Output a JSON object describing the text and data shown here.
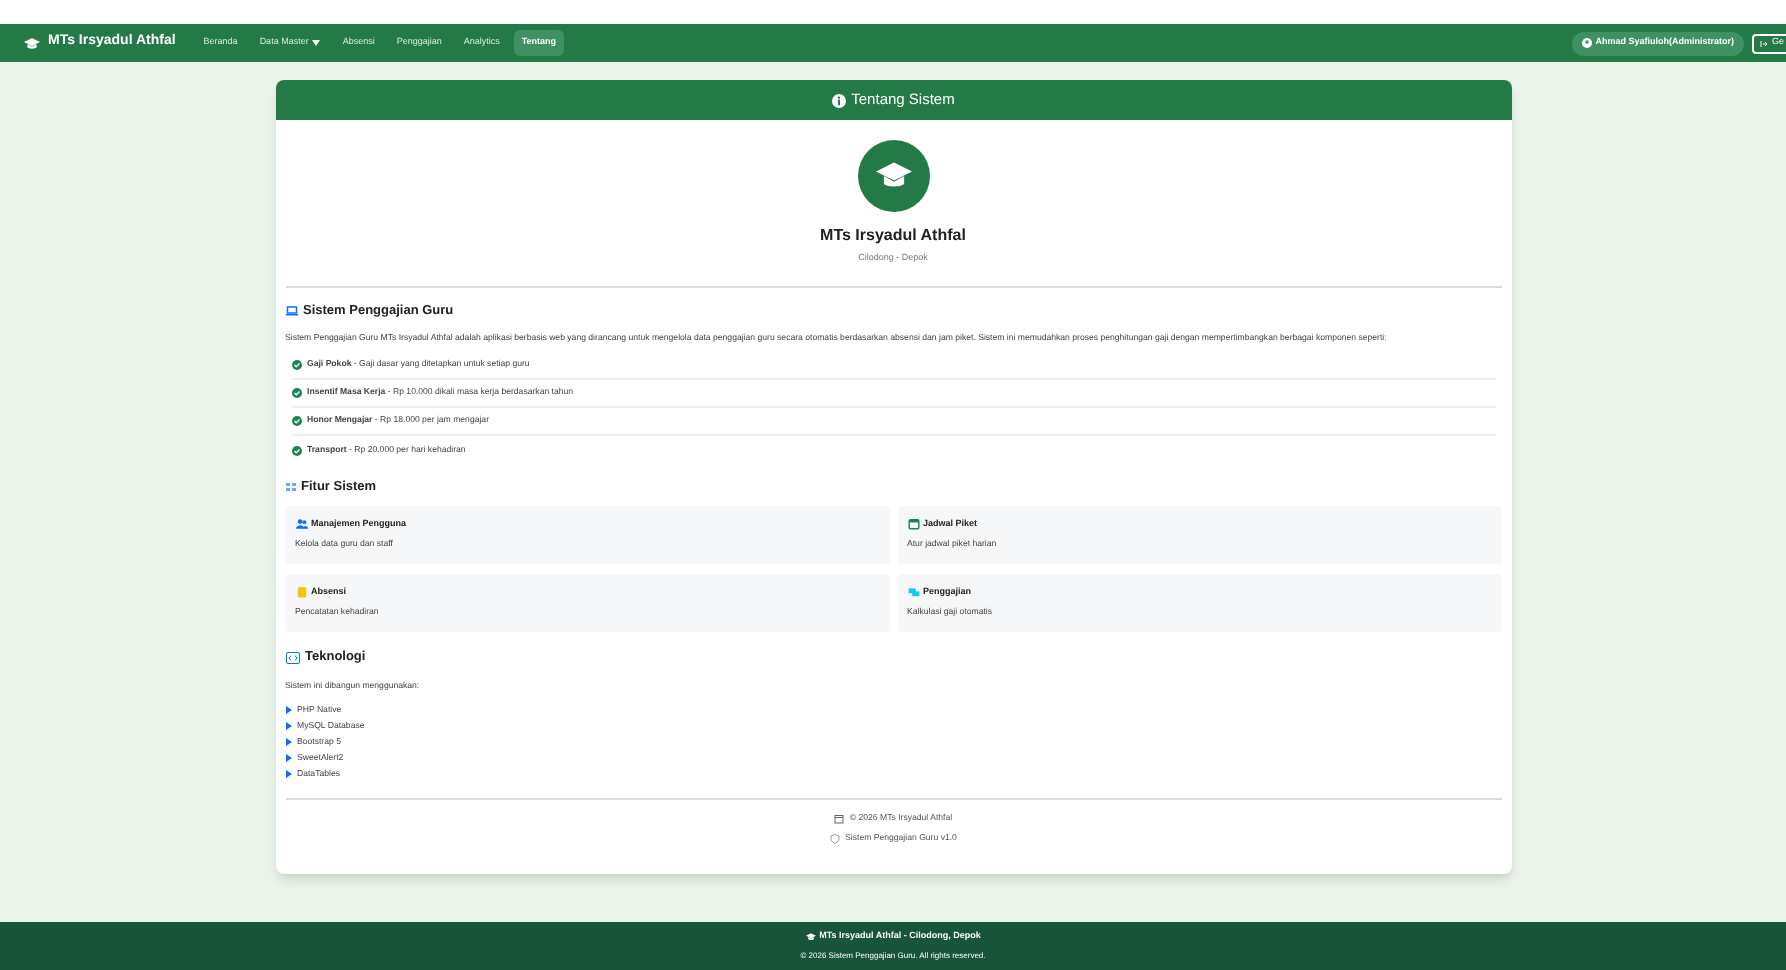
{
  "navbar": {
    "brand": "MTs Irsyadul Athfal",
    "items": [
      {
        "label": "Beranda",
        "selected": false,
        "dropdown": false
      },
      {
        "label": "Data Master",
        "selected": false,
        "dropdown": true
      },
      {
        "label": "Absensi",
        "selected": false,
        "dropdown": false
      },
      {
        "label": "Penggajian",
        "selected": false,
        "dropdown": false
      },
      {
        "label": "Analytics",
        "selected": false,
        "dropdown": false
      },
      {
        "label": "Tentang",
        "selected": true,
        "dropdown": false
      }
    ],
    "user": "Ahmad Syafiuloh(Administrator)",
    "logout": "Ge"
  },
  "card": {
    "title": "Tentang Sistem",
    "school": "MTs Irsyadul Athfal",
    "location": "Cilodong - Depok",
    "section_1": {
      "heading": "Sistem Penggajian Guru",
      "text": "Sistem Penggajian Guru MTs Irsyadul Athfal adalah aplikasi berbasis web yang dirancang untuk mengelola data penggajian guru secara otomatis berdasarkan absensi dan jam piket. Sistem ini memudahkan proses penghitungan gaji dengan mempertimbangkan berbagai komponen seperti:",
      "components": [
        {
          "text": "**Gaji Pokok** - Gaji dasar yang ditetapkan untuk setiap guru"
        },
        {
          "text": "**Insentif Masa Kerja** - Rp 10.000 dikali masa kerja berdasarkan tahun"
        },
        {
          "text": "**Honor Mengajar** - Rp 18.000 per jam mengajar"
        },
        {
          "text": "**Transport** - Rp 20.000 per hari kehadiran"
        }
      ]
    },
    "section_2": {
      "heading": "Fitur Sistem",
      "features": [
        {
          "kind": "users",
          "title": "Manajemen Pengguna",
          "desc": "Kelola data guru dan staff",
          "color": "#0d6efd"
        },
        {
          "kind": "calendar",
          "title": "Jadwal Piket",
          "desc": "Atur jadwal piket harian",
          "color": "#198754"
        },
        {
          "kind": "clipboard",
          "title": "Absensi",
          "desc": "Pencatatan kehadiran",
          "color": "#ffc107"
        },
        {
          "kind": "money",
          "title": "Penggajian",
          "desc": "Kalkulasi gaji otomatis",
          "color": "#0dcaf0"
        }
      ]
    },
    "section_3": {
      "heading": "Teknologi",
      "intro": "Sistem ini dibangun menggunakan:",
      "items": [
        "PHP Native",
        "MySQL Database",
        "Bootstrap 5",
        "SweetAlert2",
        "DataTables"
      ]
    },
    "footer": {
      "copyright": "© 2026 MTs Irsyadul Athfal",
      "version": "Sistem Penggajian Guru v1.0"
    }
  },
  "page_footer": {
    "title": "MTs Irsyadul Athfal - Cilodong, Depok",
    "copyright": "© 2026 Sistem Penggajian Guru. All rights reserved."
  }
}
